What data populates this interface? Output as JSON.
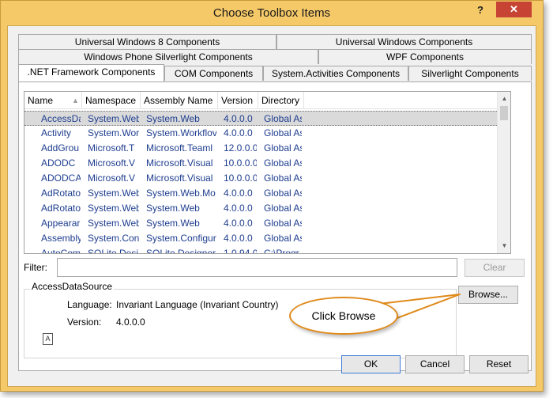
{
  "window": {
    "title": "Choose Toolbox Items",
    "help_glyph": "?",
    "close_glyph": "✕"
  },
  "tabs": {
    "row1": [
      "Universal Windows 8 Components",
      "Universal Windows Components"
    ],
    "row2": [
      "Windows Phone Silverlight Components",
      "WPF Components"
    ],
    "row3": [
      ".NET Framework Components",
      "COM Components",
      "System.Activities Components",
      "Silverlight Components"
    ],
    "active": ".NET Framework Components"
  },
  "grid": {
    "columns": [
      "Name",
      "Namespace",
      "Assembly Name",
      "Version",
      "Directory"
    ],
    "sort_glyph": "▲",
    "rows": [
      {
        "name": "AccessDa",
        "namespace": "System.Web",
        "assembly": "System.Web",
        "version": "4.0.0.0",
        "directory": "Global As",
        "selected": true
      },
      {
        "name": "Activity",
        "namespace": "System.Wor",
        "assembly": "System.Workflov",
        "version": "4.0.0.0",
        "directory": "Global As"
      },
      {
        "name": "AddGrou",
        "namespace": "Microsoft.T",
        "assembly": "Microsoft.Teaml",
        "version": "12.0.0.0",
        "directory": "Global As"
      },
      {
        "name": "ADODC",
        "namespace": "Microsoft.V",
        "assembly": "Microsoft.Visual",
        "version": "10.0.0.0",
        "directory": "Global As"
      },
      {
        "name": "ADODCA",
        "namespace": "Microsoft.V",
        "assembly": "Microsoft.Visual",
        "version": "10.0.0.0",
        "directory": "Global As"
      },
      {
        "name": "AdRotato",
        "namespace": "System.Web",
        "assembly": "System.Web.Mo",
        "version": "4.0.0.0",
        "directory": "Global As"
      },
      {
        "name": "AdRotato",
        "namespace": "System.Web",
        "assembly": "System.Web",
        "version": "4.0.0.0",
        "directory": "Global As"
      },
      {
        "name": "Appearar",
        "namespace": "System.Web",
        "assembly": "System.Web",
        "version": "4.0.0.0",
        "directory": "Global As"
      },
      {
        "name": "Assembly",
        "namespace": "System.Con",
        "assembly": "System.Configur",
        "version": "4.0.0.0",
        "directory": "Global As"
      },
      {
        "name": "AutoCom",
        "namespace": "SQLite.Desi",
        "assembly": "SQLite.Designer",
        "version": "1.0.94.0",
        "directory": "C:\\Progr"
      }
    ]
  },
  "filter": {
    "label": "Filter:",
    "value": "",
    "clear_label": "Clear"
  },
  "details": {
    "group_title": "AccessDataSource",
    "language_label": "Language:",
    "language_value": "Invariant Language (Invariant Country)",
    "version_label": "Version:",
    "version_value": "4.0.0.0",
    "browse_label": "Browse..."
  },
  "callout": {
    "text": "Click Browse"
  },
  "footer": {
    "ok_label": "OK",
    "cancel_label": "Cancel",
    "reset_label": "Reset"
  },
  "colors": {
    "frame": "#f6c968",
    "close": "#c74434",
    "link_text": "#1e3d8f",
    "callout_border": "#e08a1a"
  }
}
